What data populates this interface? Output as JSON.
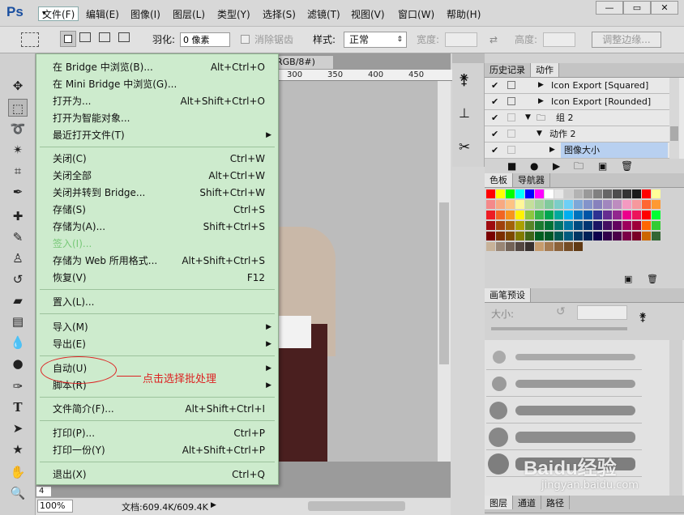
{
  "app": {
    "logo": "Ps"
  },
  "menu": [
    "文件(F)",
    "编辑(E)",
    "图像(I)",
    "图层(L)",
    "类型(Y)",
    "选择(S)",
    "滤镜(T)",
    "视图(V)",
    "窗口(W)",
    "帮助(H)"
  ],
  "window_buttons": [
    "—",
    "▭",
    "✕"
  ],
  "options": {
    "feather_label": "羽化:",
    "feather_value": "0 像素",
    "antialias": "消除锯齿",
    "style_label": "样式:",
    "style_value": "正常",
    "width_label": "宽度:",
    "height_label": "高度:",
    "refine_button": "调整边缘..."
  },
  "document": {
    "tab": "RGB/8#) *",
    "ruler_ticks": [
      "300",
      "350",
      "400",
      "450"
    ],
    "zoom": "100%",
    "doc_info": "文档:609.4K/609.4K",
    "page_indicator": "4"
  },
  "file_menu": [
    {
      "label": "在 Bridge 中浏览(B)...",
      "shortcut": "Alt+Ctrl+O"
    },
    {
      "label": "在 Mini Bridge 中浏览(G)...",
      "shortcut": ""
    },
    {
      "label": "打开为...",
      "shortcut": "Alt+Shift+Ctrl+O"
    },
    {
      "label": "打开为智能对象...",
      "shortcut": ""
    },
    {
      "label": "最近打开文件(T)",
      "shortcut": "",
      "submenu": true
    },
    {
      "label": "关闭(C)",
      "shortcut": "Ctrl+W"
    },
    {
      "label": "关闭全部",
      "shortcut": "Alt+Ctrl+W"
    },
    {
      "label": "关闭并转到 Bridge...",
      "shortcut": "Shift+Ctrl+W"
    },
    {
      "label": "存储(S)",
      "shortcut": "Ctrl+S"
    },
    {
      "label": "存储为(A)...",
      "shortcut": "Shift+Ctrl+S"
    },
    {
      "label": "签入(I)...",
      "shortcut": "",
      "disabled": true
    },
    {
      "label": "存储为 Web 所用格式...",
      "shortcut": "Alt+Shift+Ctrl+S"
    },
    {
      "label": "恢复(V)",
      "shortcut": "F12"
    },
    {
      "label": "置入(L)...",
      "shortcut": ""
    },
    {
      "label": "导入(M)",
      "shortcut": "",
      "submenu": true
    },
    {
      "label": "导出(E)",
      "shortcut": "",
      "submenu": true
    },
    {
      "label": "自动(U)",
      "shortcut": "",
      "submenu": true
    },
    {
      "label": "脚本(R)",
      "shortcut": "",
      "submenu": true
    },
    {
      "label": "文件简介(F)...",
      "shortcut": "Alt+Shift+Ctrl+I"
    },
    {
      "label": "打印(P)...",
      "shortcut": "Ctrl+P"
    },
    {
      "label": "打印一份(Y)",
      "shortcut": "Alt+Shift+Ctrl+P"
    },
    {
      "label": "退出(X)",
      "shortcut": "Ctrl+Q"
    }
  ],
  "annotation": "点击选择批处理",
  "panels": {
    "history_tabs": [
      "历史记录",
      "动作"
    ],
    "actions": [
      {
        "label": "Icon Export [Squared]",
        "type": "action"
      },
      {
        "label": "Icon Export [Rounded]",
        "type": "action"
      },
      {
        "label": "组 2",
        "type": "set"
      },
      {
        "label": "动作 2",
        "type": "action"
      },
      {
        "label": "图像大小",
        "type": "step"
      }
    ],
    "swatch_tabs": [
      "色板",
      "导航器"
    ],
    "brush_tab": "画笔预设",
    "size_label": "大小:",
    "bottom_tabs": [
      "图层",
      "通道",
      "路径"
    ]
  },
  "watermark": {
    "brand": "Baidu经验",
    "url": "jingyan.baidu.com"
  },
  "swatch_colors": [
    "#ff0000",
    "#ffff00",
    "#00ff00",
    "#00ffff",
    "#0000ff",
    "#ff00ff",
    "#ffffff",
    "#e6e6e6",
    "#cccccc",
    "#b3b3b3",
    "#999999",
    "#808080",
    "#666666",
    "#4d4d4d",
    "#333333",
    "#1a1a1a",
    "#ff0000",
    "#ffff99",
    "#f48989",
    "#f8a981",
    "#fdc383",
    "#fff799",
    "#c4df9b",
    "#a3d39c",
    "#81ca9d",
    "#7bcdc8",
    "#6dcff6",
    "#7da7d8",
    "#8393ca",
    "#8781bd",
    "#a186be",
    "#bd8cbf",
    "#f49ac1",
    "#f6989d",
    "#ff6633",
    "#ff9933",
    "#ed1c24",
    "#f26522",
    "#f7941d",
    "#fff200",
    "#8dc63f",
    "#39b54a",
    "#00a651",
    "#00a99d",
    "#00aeef",
    "#0072bc",
    "#0054a6",
    "#2e3192",
    "#662d91",
    "#92278f",
    "#ec008c",
    "#ed145b",
    "#ff0000",
    "#00ff33",
    "#9e0b0f",
    "#a0410d",
    "#a3620a",
    "#aba000",
    "#598527",
    "#1a7b30",
    "#007236",
    "#00746b",
    "#0076a3",
    "#004b80",
    "#003471",
    "#1b1464",
    "#440e62",
    "#630460",
    "#9e005d",
    "#9e0039",
    "#ff6600",
    "#33cc33",
    "#790000",
    "#7b2e00",
    "#7d4900",
    "#827b00",
    "#406618",
    "#005e20",
    "#005826",
    "#005952",
    "#005b7f",
    "#003663",
    "#002157",
    "#0d004c",
    "#32004b",
    "#4b0049",
    "#7b0046",
    "#7a0026",
    "#cc6600",
    "#336633",
    "#c7b299",
    "#998675",
    "#736357",
    "#534741",
    "#37302d",
    "#c69c6d",
    "#a67c52",
    "#8c6239",
    "#754c24",
    "#603913"
  ]
}
